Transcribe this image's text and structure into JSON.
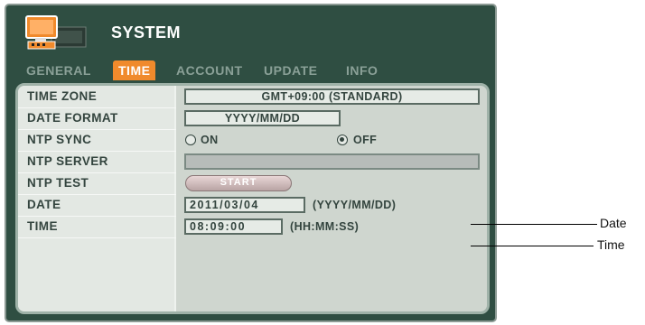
{
  "window": {
    "title": "SYSTEM",
    "icon": "system-setup-icon"
  },
  "tabs": [
    {
      "label": "GENERAL",
      "active": false
    },
    {
      "label": "TIME",
      "active": true
    },
    {
      "label": "ACCOUNT",
      "active": false
    },
    {
      "label": "UPDATE",
      "active": false
    },
    {
      "label": "INFO",
      "active": false
    }
  ],
  "rows": {
    "time_zone": {
      "label": "TIME ZONE",
      "value": "GMT+09:00 (STANDARD)"
    },
    "date_format": {
      "label": "DATE FORMAT",
      "value": "YYYY/MM/DD"
    },
    "ntp_sync": {
      "label": "NTP SYNC",
      "on_label": "ON",
      "off_label": "OFF",
      "selected": "OFF"
    },
    "ntp_server": {
      "label": "NTP SERVER",
      "value": ""
    },
    "ntp_test": {
      "label": "NTP TEST",
      "button": "START"
    },
    "date": {
      "label": "DATE",
      "value": "2011/03/04",
      "hint": "(YYYY/MM/DD)"
    },
    "time": {
      "label": "TIME",
      "value": "08:09:00",
      "hint": "(HH:MM:SS)"
    }
  },
  "callouts": {
    "date": "Date",
    "time": "Time"
  },
  "colors": {
    "window_bg": "#2f4e42",
    "active_tab": "#f08a2c",
    "panel_bg": "#cfd6cf",
    "inactive_tab": "#8aa097"
  }
}
